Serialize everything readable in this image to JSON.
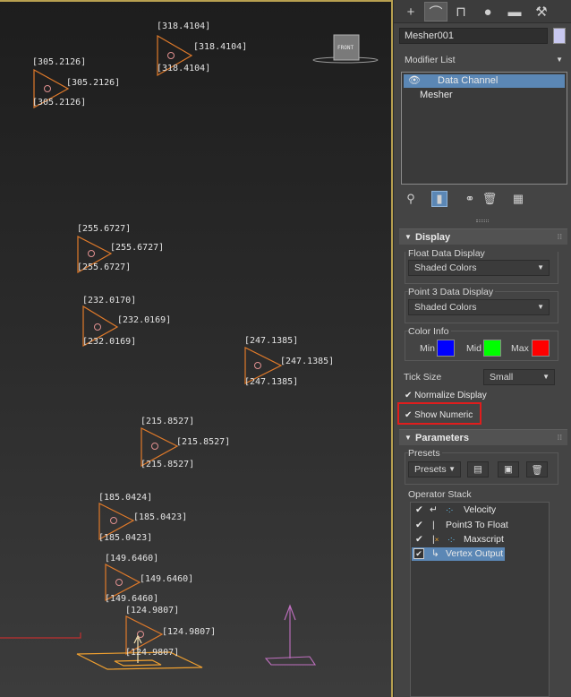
{
  "viewport": {
    "view_cube_label": "FRONT",
    "labels": [
      {
        "id": "318a",
        "text": "[318.4104]"
      },
      {
        "id": "318b",
        "text": "[318.4104]"
      },
      {
        "id": "318c",
        "text": "[318.4104]"
      },
      {
        "id": "305a",
        "text": "[305.2126]"
      },
      {
        "id": "305b",
        "text": "[305.2126]"
      },
      {
        "id": "305c",
        "text": "[305.2126]"
      },
      {
        "id": "255a",
        "text": "[255.6727]"
      },
      {
        "id": "255b",
        "text": "[255.6727]"
      },
      {
        "id": "255c",
        "text": "[255.6727]"
      },
      {
        "id": "232a",
        "text": "[232.0170]"
      },
      {
        "id": "232b",
        "text": "[232.0169]"
      },
      {
        "id": "232c",
        "text": "[232.0169]"
      },
      {
        "id": "247a",
        "text": "[247.1385]"
      },
      {
        "id": "247b",
        "text": "[247.1385]"
      },
      {
        "id": "247c",
        "text": "[247.1385]"
      },
      {
        "id": "215a",
        "text": "[215.8527]"
      },
      {
        "id": "215b",
        "text": "[215.8527]"
      },
      {
        "id": "215c",
        "text": "[215.8527]"
      },
      {
        "id": "185a",
        "text": "[185.0424]"
      },
      {
        "id": "185b",
        "text": "[185.0423]"
      },
      {
        "id": "185c",
        "text": "[185.0423]"
      },
      {
        "id": "149a",
        "text": "[149.6460]"
      },
      {
        "id": "149b",
        "text": "[149.6460]"
      },
      {
        "id": "149c",
        "text": "[149.6460]"
      },
      {
        "id": "124a",
        "text": "[124.9807]"
      },
      {
        "id": "124b",
        "text": "[124.9807]"
      },
      {
        "id": "124c",
        "text": "[124.9807]"
      }
    ]
  },
  "panel": {
    "tabs": [
      {
        "name": "create-tab",
        "icon": "plus-icon",
        "glyph": "+"
      },
      {
        "name": "modify-tab",
        "icon": "modify-curve-icon",
        "glyph": "⌒"
      },
      {
        "name": "hierarchy-tab",
        "icon": "hierarchy-icon",
        "glyph": "⊓"
      },
      {
        "name": "motion-tab",
        "icon": "motion-icon",
        "glyph": "●"
      },
      {
        "name": "display-tab",
        "icon": "monitor-icon",
        "glyph": "▬"
      },
      {
        "name": "utilities-tab",
        "icon": "wrench-icon",
        "glyph": "⚒"
      }
    ],
    "object_name": "Mesher001",
    "object_color": "#c8c8f0",
    "modifier_list_label": "Modifier List",
    "stack_items": [
      {
        "label": "Data Channel",
        "selected": true,
        "eye_icon": "eye-icon"
      },
      {
        "label": "Mesher",
        "selected": false
      }
    ],
    "display": {
      "title": "Display",
      "float_data_label": "Float Data Display",
      "float_data_value": "Shaded Colors",
      "point3_label": "Point 3 Data Display",
      "point3_value": "Shaded Colors",
      "color_info_label": "Color Info",
      "min_label": "Min",
      "mid_label": "Mid",
      "max_label": "Max",
      "min_color": "#0000ff",
      "mid_color": "#00ff00",
      "max_color": "#ff0000",
      "tick_size_label": "Tick Size",
      "tick_size_value": "Small",
      "normalize_label": "Normalize Display",
      "show_numeric_label": "Show Numeric"
    },
    "parameters": {
      "title": "Parameters",
      "presets_label": "Presets",
      "presets_button": "Presets",
      "operator_stack_label": "Operator Stack",
      "operators": [
        {
          "label": "Velocity",
          "checked": true,
          "selected": false
        },
        {
          "label": "Point3 To Float",
          "checked": true,
          "selected": false
        },
        {
          "label": "Maxscript",
          "checked": true,
          "selected": false
        },
        {
          "label": "Vertex Output",
          "checked": true,
          "selected": true
        }
      ]
    },
    "accent_color": "#5b87b5",
    "highlight_color": "#e01d1d"
  }
}
